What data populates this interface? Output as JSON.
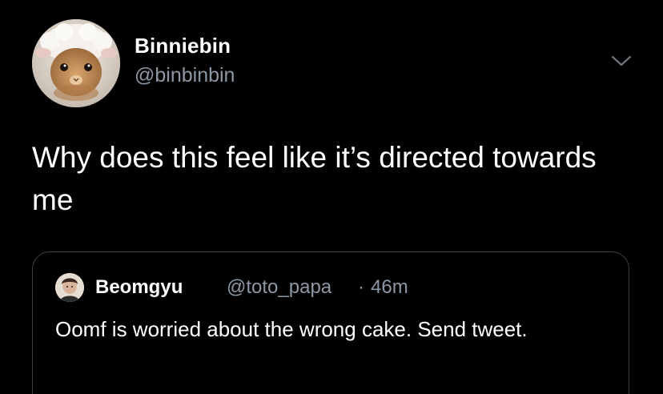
{
  "tweet": {
    "author": {
      "display_name": "Binniebin",
      "handle": "@binbinbin",
      "avatar_icon": "bunny-in-sheep-hat-avatar"
    },
    "more_icon": "chevron-down-icon",
    "text": "Why does this feel like it’s directed towards me",
    "quote": {
      "author": {
        "display_name": "Beomgyu",
        "handle": "@toto_papa",
        "avatar_icon": "person-avatar"
      },
      "separator": "·",
      "time": "46m",
      "text": "Oomf is worried about the wrong cake. Send tweet."
    }
  },
  "colors": {
    "background": "#000000",
    "primary_text": "#ffffff",
    "secondary_text": "#8b98a5",
    "border": "#3d4349"
  }
}
